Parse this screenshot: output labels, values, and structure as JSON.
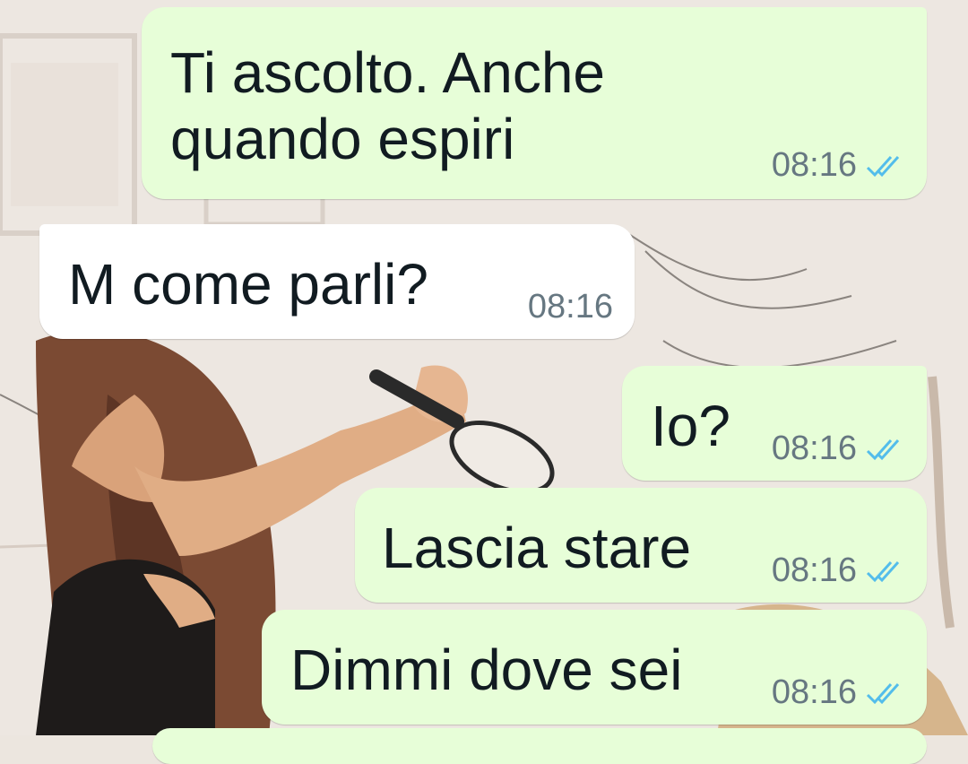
{
  "colors": {
    "outgoing_bubble": "#e7fed8",
    "incoming_bubble": "#ffffff",
    "text": "#111b21",
    "timestamp": "#667781",
    "read_ticks": "#53bdeb"
  },
  "messages": [
    {
      "direction": "outgoing",
      "text": "Ti ascolto. Anche\nquando espiri",
      "time": "08:16",
      "status_icon": "double-check-read-icon"
    },
    {
      "direction": "incoming",
      "text": "M come parli?",
      "time": "08:16"
    },
    {
      "direction": "outgoing",
      "text": "Io?",
      "time": "08:16",
      "status_icon": "double-check-read-icon"
    },
    {
      "direction": "outgoing",
      "text": "Lascia stare",
      "time": "08:16",
      "status_icon": "double-check-read-icon"
    },
    {
      "direction": "outgoing",
      "text": "Dimmi dove sei",
      "time": "08:16",
      "status_icon": "double-check-read-icon"
    }
  ]
}
